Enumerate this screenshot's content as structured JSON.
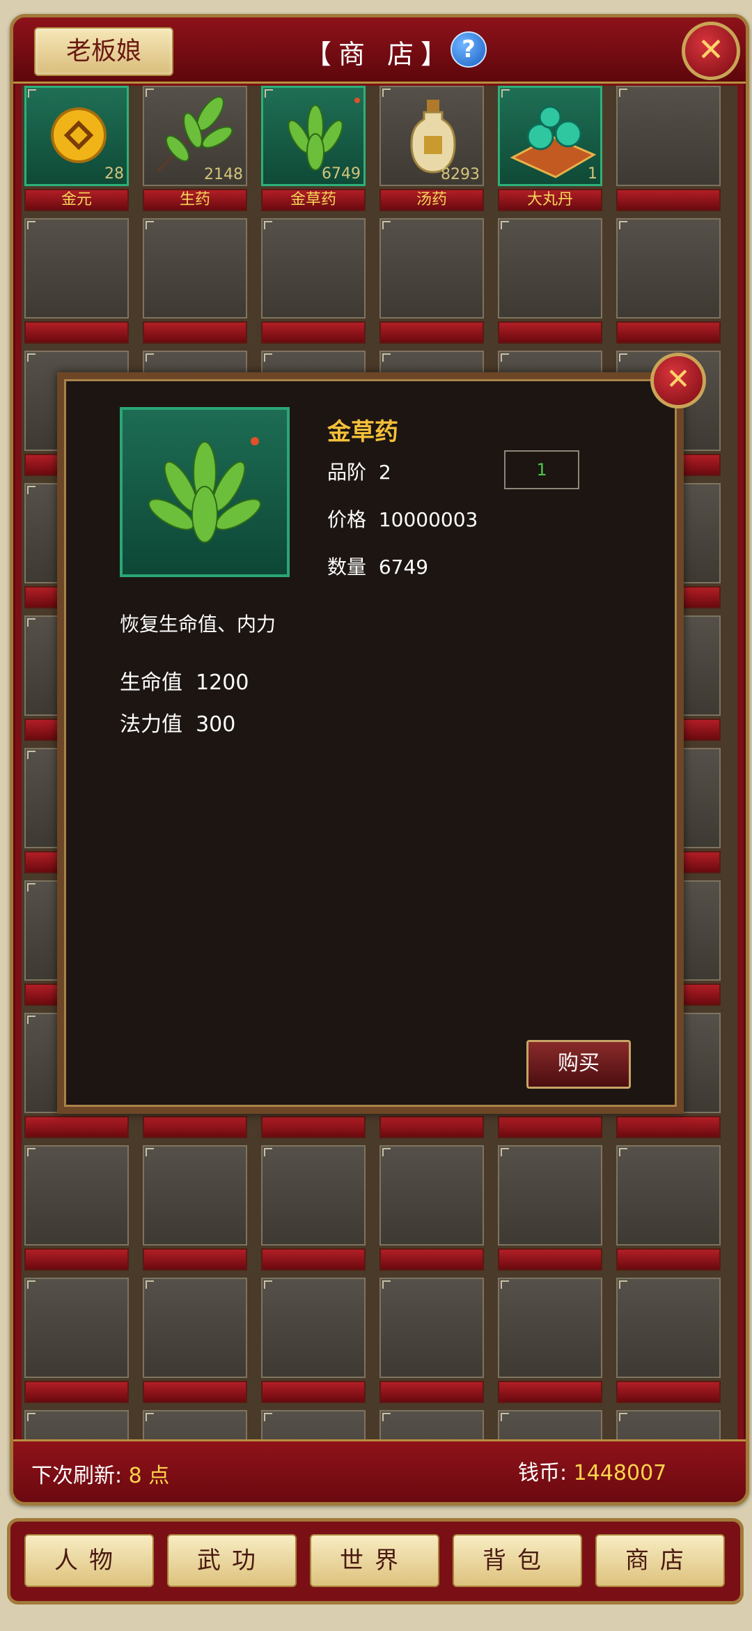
{
  "header": {
    "owner_button": "老板娘",
    "title": "【商 店】",
    "help_icon": "?",
    "close_icon": "✕"
  },
  "items": [
    {
      "name": "金元",
      "qty": "28",
      "icon": "gold-coin-icon",
      "active": true
    },
    {
      "name": "生药",
      "qty": "2148",
      "icon": "herb-branch-icon",
      "active": false
    },
    {
      "name": "金草药",
      "qty": "6749",
      "icon": "golden-herb-icon",
      "active": true
    },
    {
      "name": "汤药",
      "qty": "8293",
      "icon": "potion-bottle-icon",
      "active": false
    },
    {
      "name": "大丸丹",
      "qty": "1",
      "icon": "jade-pills-icon",
      "active": true
    }
  ],
  "popup": {
    "name": "金草药",
    "grade_label": "品阶",
    "grade_value": "2",
    "price_label": "价格",
    "price_value": "10000003",
    "count_label": "数量",
    "count_value": "6749",
    "quantity_input": "1",
    "description": "恢复生命值、内力",
    "hp_label": "生命值",
    "hp_value": "1200",
    "mp_label": "法力值",
    "mp_value": "300",
    "buy_button": "购买",
    "close_icon": "✕"
  },
  "status": {
    "refresh_label": "下次刷新:",
    "refresh_value": "8 点",
    "coins_label": "钱币:",
    "coins_value": "1448007"
  },
  "nav": [
    "人物",
    "武功",
    "世界",
    "背包",
    "商店"
  ],
  "colors": {
    "frame_red": "#7a1016",
    "gold": "#f5c03a",
    "active_slot": "#1f6f55"
  }
}
